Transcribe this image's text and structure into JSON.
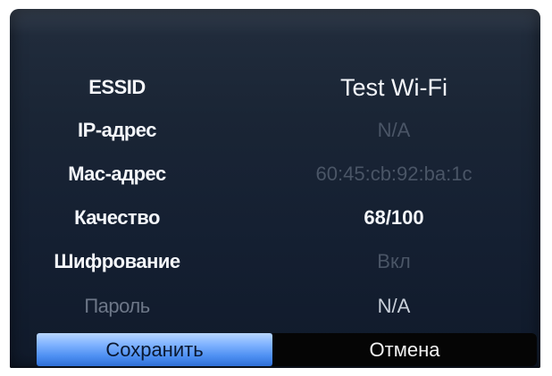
{
  "rows": [
    {
      "label": "ESSID",
      "value": "Test Wi-Fi"
    },
    {
      "label": "IP-адрес",
      "value": "N/A"
    },
    {
      "label": "Mac-адрес",
      "value": "60:45:cb:92:ba:1c"
    },
    {
      "label": "Качество",
      "value": "68/100"
    },
    {
      "label": "Шифрование",
      "value": "Вкл"
    },
    {
      "label": "Пароль",
      "value": "N/A"
    }
  ],
  "buttons": {
    "save_label": "Сохранить",
    "cancel_label": "Отмена"
  },
  "colors": {
    "panel_background": "#1a2535",
    "text_primary": "#f4f6fa",
    "text_disabled": "#4a5566",
    "save_button_accent": "#4d8ff2",
    "cancel_button_background": "#050505"
  }
}
